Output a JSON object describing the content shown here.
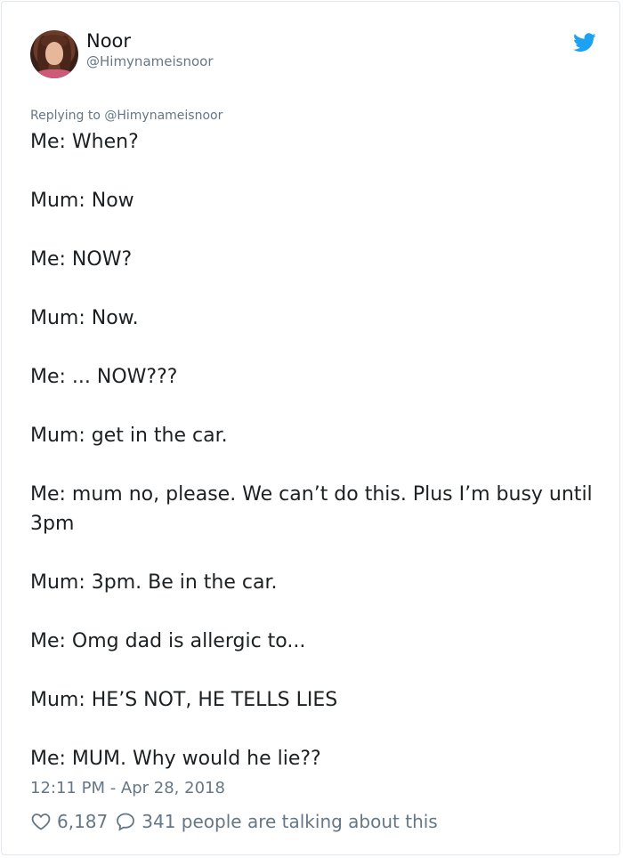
{
  "tweet": {
    "author_name": "Noor",
    "author_handle": "@Himynameisnoor",
    "replying_to": "Replying to @Himynameisnoor",
    "lines": [
      "Me: When?",
      "Mum: Now",
      "Me: NOW?",
      "Mum: Now.",
      "Me: ... NOW???",
      "Mum: get in the car.",
      "Me: mum no, please. We can’t do this. Plus I’m busy until 3pm",
      "Mum: 3pm. Be in the car.",
      "Me: Omg dad is allergic to...",
      "Mum: HE’S NOT, HE TELLS LIES",
      "Me: MUM. Why would he lie??"
    ],
    "timestamp": "12:11 PM - Apr 28, 2018",
    "likes": "6,187",
    "talking": "341 people are talking about this"
  },
  "icons": {
    "brand": "twitter-bird-icon",
    "like": "heart-icon",
    "reply": "speech-bubble-icon"
  },
  "colors": {
    "brand_blue": "#1da1f2",
    "text": "#1c2022",
    "muted": "#657786"
  }
}
